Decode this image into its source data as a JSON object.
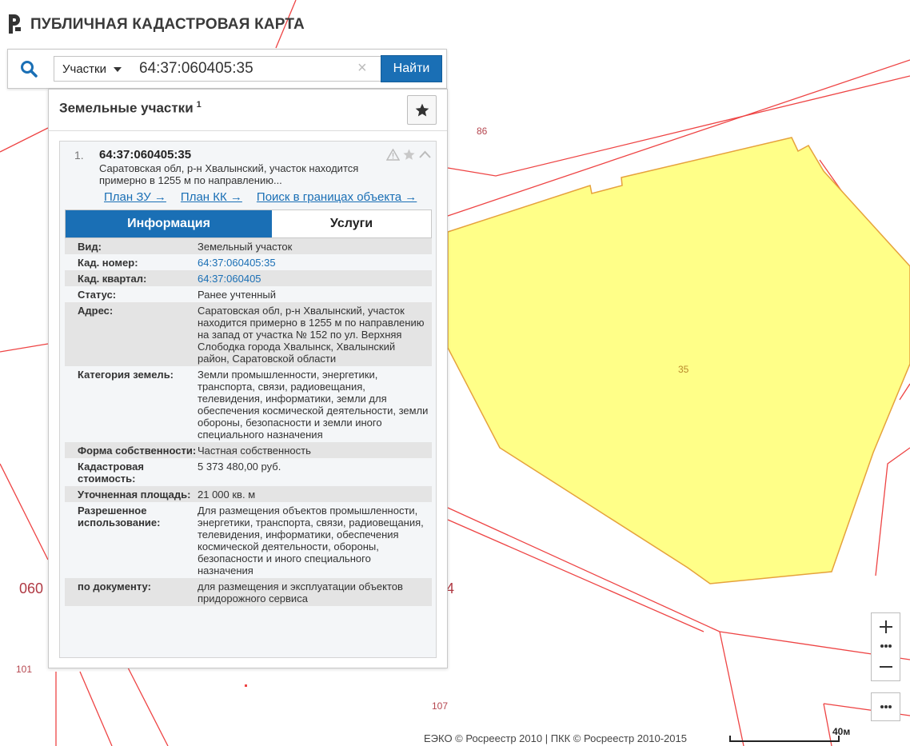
{
  "brand": {
    "title": "ПУБЛИЧНАЯ КАДАСТРОВАЯ КАРТА"
  },
  "search": {
    "type_selected": "Участки",
    "query": "64:37:060405:35",
    "find_label": "Найти"
  },
  "panel": {
    "title": "Земельные участки",
    "count": "1"
  },
  "result": {
    "index": "1.",
    "number": "64:37:060405:35",
    "address_short": "Саратовская обл, р-н Хвалынский, участок находится примерно в 1255 м по направлению...",
    "links": [
      "План ЗУ →",
      "План КК →",
      "Поиск в границах объекта →"
    ],
    "tabs": [
      "Информация",
      "Услуги"
    ],
    "rows": [
      {
        "key": "Вид:",
        "value": "Земельный участок",
        "link": false
      },
      {
        "key": "Кад. номер:",
        "value": "64:37:060405:35",
        "link": true
      },
      {
        "key": "Кад. квартал:",
        "value": "64:37:060405",
        "link": true
      },
      {
        "key": "Статус:",
        "value": "Ранее учтенный",
        "link": false
      },
      {
        "key": "Адрес:",
        "value": "Саратовская обл, р-н Хвалынский, участок находится примерно в 1255 м по направлению на запад от участка № 152 по ул. Верхняя Слободка города Хвалынск, Хвалынский район, Саратовской области",
        "link": false
      },
      {
        "key": "Категория земель:",
        "value": "Земли промышленности, энергетики, транспорта, связи, радиовещания, телевидения, информатики, земли для обеспечения космической деятельности, земли обороны, безопасности и земли иного специального назначения",
        "link": false
      },
      {
        "key": "Форма собственности:",
        "value": "Частная собственность",
        "link": false
      },
      {
        "key": "Кадастровая стоимость:",
        "value": "5 373 480,00 руб.",
        "link": false
      },
      {
        "key": "Уточненная площадь:",
        "value": "21 000 кв. м",
        "link": false
      },
      {
        "key": "Разрешенное использование:",
        "value": "Для размещения объектов промышленности, энергетики, транспорта, связи, радиовещания, телевидения, информатики, обеспечения космической деятельности, обороны, безопасности и иного специального назначения",
        "link": false
      },
      {
        "key": "по документу:",
        "value": "для размещения и эксплуатации объектов придорожного сервиса",
        "link": false
      }
    ]
  },
  "map": {
    "labels": {
      "l86": "86",
      "l35": "35",
      "l101": "101",
      "l107": "107",
      "l060": "060",
      "l4": "4"
    },
    "attribution": "ЕЭКО © Росреестр 2010 | ПКК © Росреестр 2010-2015",
    "scale": "40м"
  },
  "colors": {
    "accent": "#1a6fb5",
    "parcel_fill": "#ffff88",
    "parcel_border": "#e6a23c",
    "boundary": "#ee4444"
  },
  "icons": {
    "brand": "pkk-logo-icon",
    "search": "search-icon",
    "clear": "close-icon",
    "star": "star-icon",
    "warning": "warning-icon",
    "collapse": "chevron-up-icon",
    "zoom_in": "plus-icon",
    "zoom_out": "minus-icon",
    "more": "more-icon"
  }
}
